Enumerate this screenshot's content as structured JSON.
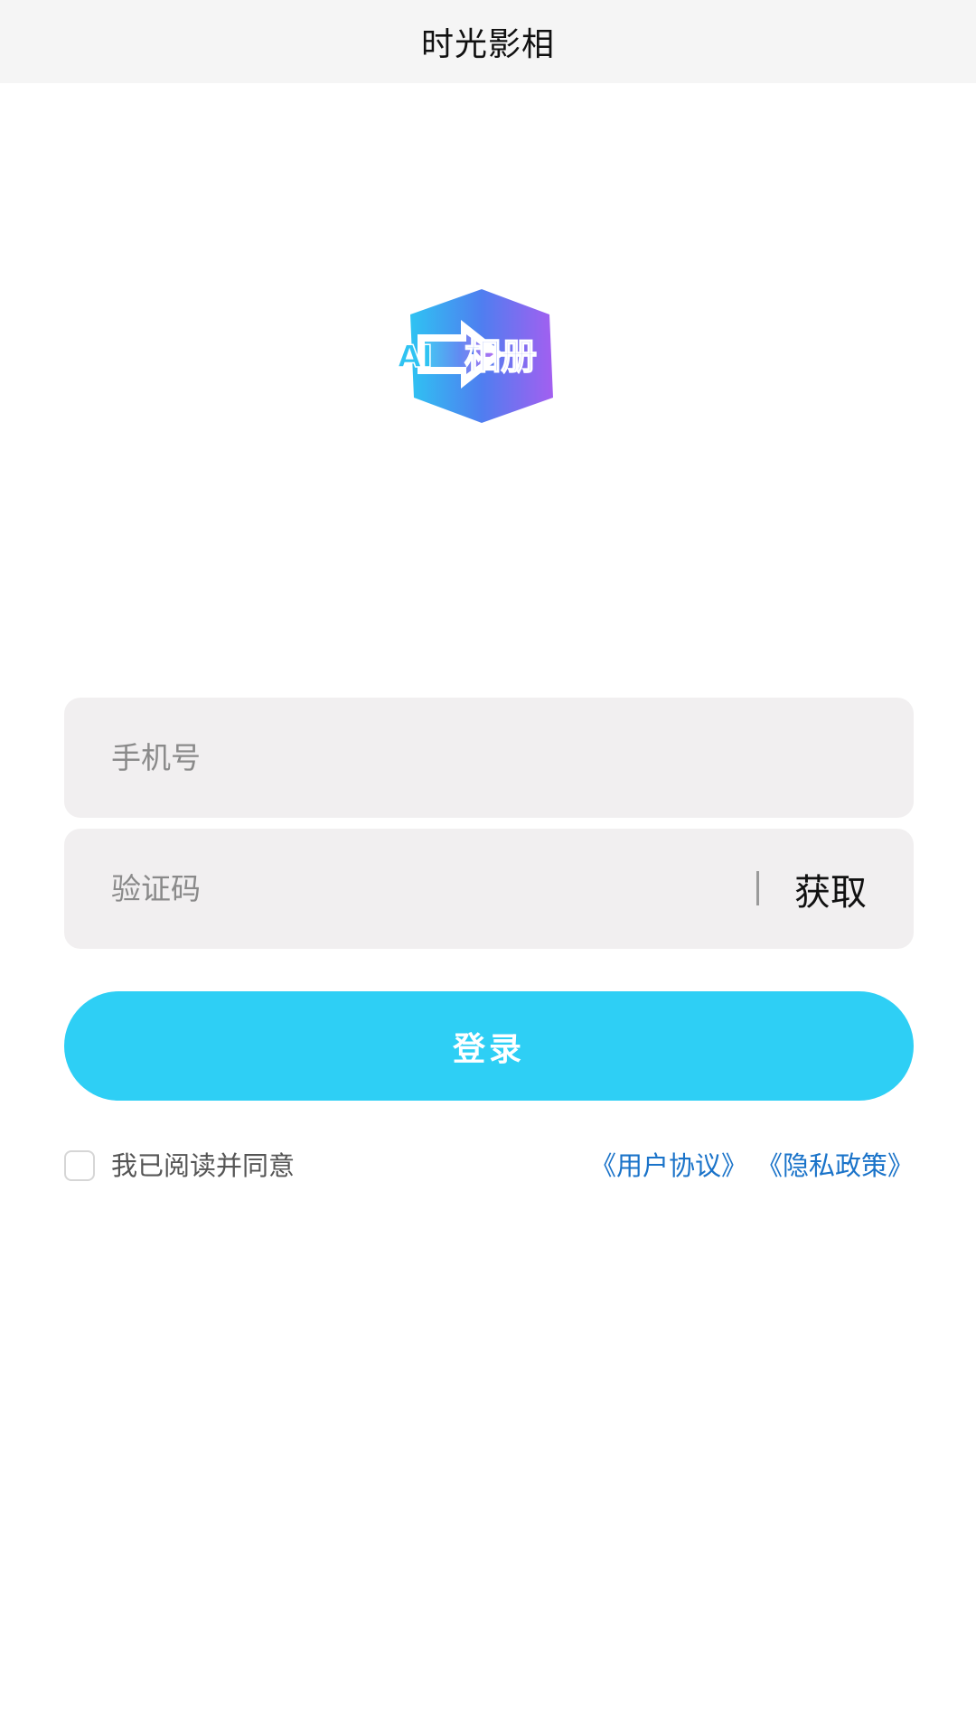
{
  "header": {
    "title": "时光影相"
  },
  "logo": {
    "text_ai": "AI",
    "text_cn": "相册",
    "colors": {
      "blue": "#3a9df5",
      "purple": "#8e5cf0",
      "cyan": "#2fc3f2"
    }
  },
  "form": {
    "phone_placeholder": "手机号",
    "phone_value": "",
    "code_placeholder": "验证码",
    "code_value": "",
    "get_code_label": "获取",
    "login_label": "登录"
  },
  "agreement": {
    "checked": false,
    "text": "我已阅读并同意",
    "user_agreement": "《用户协议》",
    "privacy_policy": "《隐私政策》"
  },
  "theme": {
    "accent": "#2ecff5",
    "link": "#1a73c9",
    "field_bg": "#f1eff0",
    "nav_bg": "#f5f5f5"
  }
}
